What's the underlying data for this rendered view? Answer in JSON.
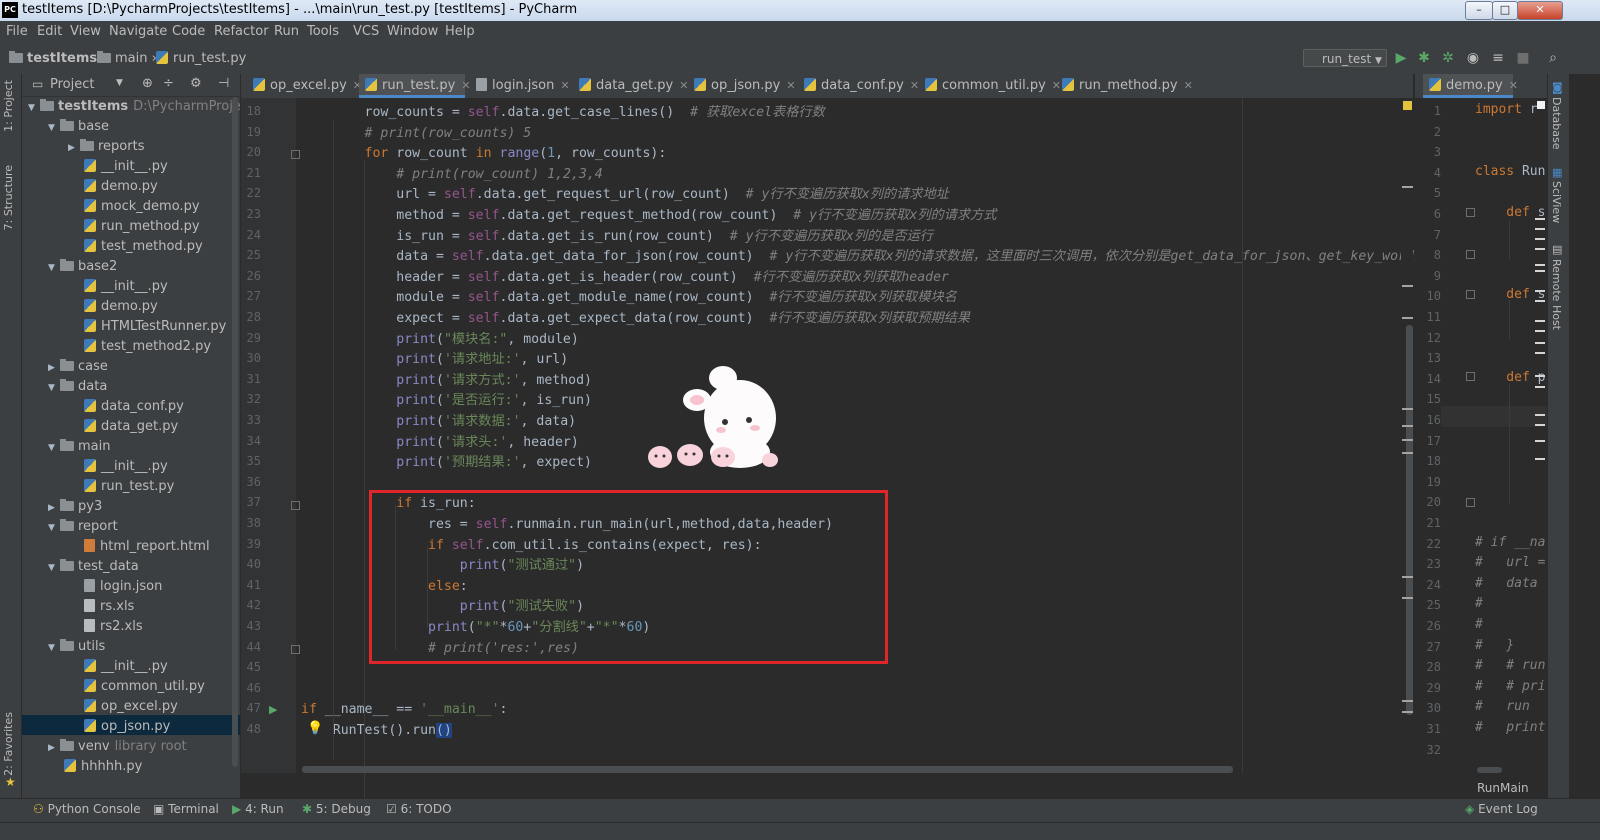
{
  "window": {
    "logo": "PC",
    "title": "testItems [D:\\PycharmProjects\\testItems] - ...\\main\\run_test.py [testItems] - PyCharm",
    "min": "–",
    "max": "□",
    "close": "✕"
  },
  "menu": [
    "File",
    "Edit",
    "View",
    "Navigate",
    "Code",
    "Refactor",
    "Run",
    "Tools",
    "VCS",
    "Window",
    "Help"
  ],
  "nav": {
    "project": "testItems",
    "folder": "main",
    "file": "run_test.py",
    "run_config": "run_test"
  },
  "left_tabs": {
    "project": "1: Project",
    "structure": "7: Structure",
    "favorites": "2: Favorites"
  },
  "project_panel": {
    "title": "Project",
    "tree": [
      {
        "label": "testItems",
        "suffix": "D:\\PycharmProjects\\t",
        "type": "folder",
        "depth": 0,
        "open": true
      },
      {
        "label": "base",
        "type": "folder",
        "depth": 1,
        "open": true
      },
      {
        "label": "reports",
        "type": "folder",
        "depth": 2,
        "open": false
      },
      {
        "label": "__init__.py",
        "type": "py",
        "depth": 2
      },
      {
        "label": "demo.py",
        "type": "py",
        "depth": 2
      },
      {
        "label": "mock_demo.py",
        "type": "py",
        "depth": 2
      },
      {
        "label": "run_method.py",
        "type": "py",
        "depth": 2
      },
      {
        "label": "test_method.py",
        "type": "py",
        "depth": 2
      },
      {
        "label": "base2",
        "type": "folder",
        "depth": 1,
        "open": true
      },
      {
        "label": "__init__.py",
        "type": "py",
        "depth": 2
      },
      {
        "label": "demo.py",
        "type": "py",
        "depth": 2
      },
      {
        "label": "HTMLTestRunner.py",
        "type": "py",
        "depth": 2
      },
      {
        "label": "test_method2.py",
        "type": "py",
        "depth": 2
      },
      {
        "label": "case",
        "type": "folder",
        "depth": 1,
        "open": false
      },
      {
        "label": "data",
        "type": "folder",
        "depth": 1,
        "open": true
      },
      {
        "label": "data_conf.py",
        "type": "py",
        "depth": 2
      },
      {
        "label": "data_get.py",
        "type": "py",
        "depth": 2
      },
      {
        "label": "main",
        "type": "folder",
        "depth": 1,
        "open": true
      },
      {
        "label": "__init__.py",
        "type": "py",
        "depth": 2
      },
      {
        "label": "run_test.py",
        "type": "py",
        "depth": 2
      },
      {
        "label": "py3",
        "type": "folder",
        "depth": 1,
        "open": false
      },
      {
        "label": "report",
        "type": "folder",
        "depth": 1,
        "open": true
      },
      {
        "label": "html_report.html",
        "type": "html",
        "depth": 2
      },
      {
        "label": "test_data",
        "type": "folder",
        "depth": 1,
        "open": true
      },
      {
        "label": "login.json",
        "type": "json",
        "depth": 2
      },
      {
        "label": "rs.xls",
        "type": "xls",
        "depth": 2
      },
      {
        "label": "rs2.xls",
        "type": "xls",
        "depth": 2
      },
      {
        "label": "utils",
        "type": "folder",
        "depth": 1,
        "open": true
      },
      {
        "label": "__init__.py",
        "type": "py",
        "depth": 2
      },
      {
        "label": "common_util.py",
        "type": "py",
        "depth": 2
      },
      {
        "label": "op_excel.py",
        "type": "py",
        "depth": 2,
        "selected": true
      },
      {
        "label": "op_json.py",
        "type": "py",
        "depth": 2
      },
      {
        "label": "venv",
        "suffix": "library root",
        "type": "folder",
        "depth": 1,
        "open": false
      },
      {
        "label": "hhhhh.py",
        "type": "py",
        "depth": 1
      }
    ]
  },
  "tabs": [
    {
      "label": "op_excel.py",
      "type": "py"
    },
    {
      "label": "run_test.py",
      "type": "py",
      "active": true
    },
    {
      "label": "login.json",
      "type": "json"
    },
    {
      "label": "data_get.py",
      "type": "py"
    },
    {
      "label": "op_json.py",
      "type": "py"
    },
    {
      "label": "data_conf.py",
      "type": "py"
    },
    {
      "label": "common_util.py",
      "type": "py"
    },
    {
      "label": "run_method.py",
      "type": "py"
    }
  ],
  "split_tab": {
    "label": "demo.py"
  },
  "right_tabs": {
    "database": "Database",
    "sciview": "SciView",
    "remote": "Remote Host"
  },
  "editor": {
    "line_numbers": [
      "18",
      "19",
      "20",
      "21",
      "22",
      "23",
      "24",
      "25",
      "26",
      "27",
      "28",
      "29",
      "30",
      "31",
      "32",
      "33",
      "34",
      "35",
      "36",
      "37",
      "38",
      "39",
      "40",
      "41",
      "42",
      "43",
      "44",
      "45",
      "46",
      "47",
      "48"
    ],
    "lines": [
      [
        [
          "",
          "        row_counts = "
        ],
        [
          "sf",
          "self"
        ],
        [
          "",
          ".data.get_case_lines()  "
        ],
        [
          "cm",
          "# 获取excel表格行数"
        ]
      ],
      [
        [
          "cm",
          "        # print(row_counts) 5"
        ]
      ],
      [
        [
          "kw",
          "        for "
        ],
        [
          "",
          "row_count "
        ],
        [
          "kw",
          "in "
        ],
        [
          "bi",
          "range"
        ],
        [
          "",
          "("
        ],
        [
          "nm",
          "1"
        ],
        [
          "",
          ", row_counts):"
        ]
      ],
      [
        [
          "cm",
          "            # print(row_count) 1,2,3,4"
        ]
      ],
      [
        [
          "",
          "            url = "
        ],
        [
          "sf",
          "self"
        ],
        [
          "",
          ".data.get_request_url(row_count)  "
        ],
        [
          "cm",
          "# y行不变遍历获取x列的请求地址"
        ]
      ],
      [
        [
          "",
          "            method = "
        ],
        [
          "sf",
          "self"
        ],
        [
          "",
          ".data.get_request_method(row_count)  "
        ],
        [
          "cm",
          "# y行不变遍历获取x列的请求方式"
        ]
      ],
      [
        [
          "",
          "            is_run = "
        ],
        [
          "sf",
          "self"
        ],
        [
          "",
          ".data.get_is_run(row_count)  "
        ],
        [
          "cm",
          "# y行不变遍历获取x列的是否运行"
        ]
      ],
      [
        [
          "",
          "            data = "
        ],
        [
          "sf",
          "self"
        ],
        [
          "",
          ".data.get_data_for_json(row_count)  "
        ],
        [
          "cm",
          "# y行不变遍历获取x列的请求数据，这里面时三次调用，依次分别是get_data_for_json、get_key_words"
        ]
      ],
      [
        [
          "",
          "            header = "
        ],
        [
          "sf",
          "self"
        ],
        [
          "",
          ".data.get_is_header(row_count)  "
        ],
        [
          "cm",
          "#行不变遍历获取x列获取header"
        ]
      ],
      [
        [
          "",
          "            module = "
        ],
        [
          "sf",
          "self"
        ],
        [
          "",
          ".data.get_module_name(row_count)  "
        ],
        [
          "cm",
          "#行不变遍历获取x列获取模块名"
        ]
      ],
      [
        [
          "",
          "            expect = "
        ],
        [
          "sf",
          "self"
        ],
        [
          "",
          ".data.get_expect_data(row_count)  "
        ],
        [
          "cm",
          "#行不变遍历获取x列获取预期结果"
        ]
      ],
      [
        [
          "bi",
          "            print"
        ],
        [
          "",
          "("
        ],
        [
          "st",
          "\"模块名:\""
        ],
        [
          "",
          ", module)"
        ]
      ],
      [
        [
          "bi",
          "            print"
        ],
        [
          "",
          "("
        ],
        [
          "st",
          "'请求地址:'"
        ],
        [
          "",
          ", url)"
        ]
      ],
      [
        [
          "bi",
          "            print"
        ],
        [
          "",
          "("
        ],
        [
          "st",
          "'请求方式:'"
        ],
        [
          "",
          ", method)"
        ]
      ],
      [
        [
          "bi",
          "            print"
        ],
        [
          "",
          "("
        ],
        [
          "st",
          "'是否运行:'"
        ],
        [
          "",
          ", is_run)"
        ]
      ],
      [
        [
          "bi",
          "            print"
        ],
        [
          "",
          "("
        ],
        [
          "st",
          "'请求数据:'"
        ],
        [
          "",
          ", data)"
        ]
      ],
      [
        [
          "bi",
          "            print"
        ],
        [
          "",
          "("
        ],
        [
          "st",
          "'请求头:'"
        ],
        [
          "",
          ", header)"
        ]
      ],
      [
        [
          "bi",
          "            print"
        ],
        [
          "",
          "("
        ],
        [
          "st",
          "'预期结果:'"
        ],
        [
          "",
          ", expect)"
        ]
      ],
      [
        [
          "",
          ""
        ]
      ],
      [
        [
          "kw",
          "            if "
        ],
        [
          "",
          "is_run:"
        ]
      ],
      [
        [
          "",
          "                res = "
        ],
        [
          "sf",
          "self"
        ],
        [
          "",
          ".runmain.run_main(url,method,data,header)"
        ]
      ],
      [
        [
          "kw",
          "                if "
        ],
        [
          "sf",
          "self"
        ],
        [
          "",
          ".com_util.is_contains(expect, res):"
        ]
      ],
      [
        [
          "bi",
          "                    print"
        ],
        [
          "",
          "("
        ],
        [
          "st",
          "\"测试通过\""
        ],
        [
          "",
          ")"
        ]
      ],
      [
        [
          "kw",
          "                else"
        ],
        [
          "",
          ":"
        ]
      ],
      [
        [
          "bi",
          "                    print"
        ],
        [
          "",
          "("
        ],
        [
          "st",
          "\"测试失败\""
        ],
        [
          "",
          ")"
        ]
      ],
      [
        [
          "bi",
          "                print"
        ],
        [
          "",
          "("
        ],
        [
          "st",
          "\"*\""
        ],
        [
          "",
          "*"
        ],
        [
          "nm",
          "60"
        ],
        [
          "",
          "+"
        ],
        [
          "st",
          "\"分割线\""
        ],
        [
          "",
          "+"
        ],
        [
          "st",
          "\"*\""
        ],
        [
          "",
          "*"
        ],
        [
          "nm",
          "60"
        ],
        [
          "",
          ")"
        ]
      ],
      [
        [
          "cm",
          "                # print('res:',res)"
        ]
      ],
      [
        [
          "",
          ""
        ]
      ],
      [
        [
          "",
          ""
        ]
      ],
      [
        [
          "kw",
          "if "
        ],
        [
          "",
          "__name__ == "
        ],
        [
          "st",
          "'__main__'"
        ],
        [
          "",
          ":"
        ]
      ],
      [
        [
          "",
          "    RunTest().run"
        ],
        [
          "sel",
          "()"
        ]
      ]
    ]
  },
  "split_editor": {
    "line_numbers": [
      "1",
      "2",
      "3",
      "4",
      "5",
      "6",
      "7",
      "8",
      "9",
      "10",
      "11",
      "12",
      "13",
      "14",
      "15",
      "16",
      "17",
      "18",
      "19",
      "20",
      "21",
      "22",
      "23",
      "24",
      "25",
      "26",
      "27",
      "28",
      "29",
      "30",
      "31",
      "32"
    ],
    "lines": [
      [
        [
          "kw",
          "import "
        ],
        [
          "",
          "r"
        ]
      ],
      [
        [
          "",
          ""
        ]
      ],
      [
        [
          "",
          ""
        ]
      ],
      [
        [
          "kw",
          "class "
        ],
        [
          "",
          "Run"
        ]
      ],
      [
        [
          "",
          ""
        ]
      ],
      [
        [
          "kw",
          "    def "
        ],
        [
          "",
          "s"
        ]
      ],
      [
        [
          "",
          ""
        ]
      ],
      [
        [
          "",
          ""
        ]
      ],
      [
        [
          "",
          ""
        ]
      ],
      [
        [
          "kw",
          "    def "
        ],
        [
          "",
          "s"
        ]
      ],
      [
        [
          "",
          ""
        ]
      ],
      [
        [
          "",
          ""
        ]
      ],
      [
        [
          "",
          ""
        ]
      ],
      [
        [
          "kw",
          "    def "
        ],
        [
          "",
          "p"
        ]
      ],
      [
        [
          "",
          ""
        ]
      ],
      [
        [
          "",
          ""
        ]
      ],
      [
        [
          "",
          ""
        ]
      ],
      [
        [
          "",
          ""
        ]
      ],
      [
        [
          "",
          ""
        ]
      ],
      [
        [
          "",
          ""
        ]
      ],
      [
        [
          "",
          ""
        ]
      ],
      [
        [
          "cm",
          "# if __na"
        ]
      ],
      [
        [
          "cm",
          "#   url ="
        ]
      ],
      [
        [
          "cm",
          "#   data"
        ]
      ],
      [
        [
          "cm",
          "#"
        ]
      ],
      [
        [
          "cm",
          "#"
        ]
      ],
      [
        [
          "cm",
          "#   }"
        ]
      ],
      [
        [
          "cm",
          "#   # run"
        ]
      ],
      [
        [
          "cm",
          "#   # pri"
        ]
      ],
      [
        [
          "cm",
          "#   run"
        ]
      ],
      [
        [
          "cm",
          "#   print"
        ]
      ],
      [
        [
          "",
          ""
        ]
      ]
    ],
    "footer": "RunMain"
  },
  "bottom_tabs": [
    {
      "label": "Python Console",
      "icon": "python-console-icon"
    },
    {
      "label": "Terminal",
      "icon": "terminal-icon"
    },
    {
      "label": "4: Run",
      "icon": "run-icon"
    },
    {
      "label": "5: Debug",
      "icon": "debug-icon"
    },
    {
      "label": "6: TODO",
      "icon": "todo-icon"
    }
  ],
  "event_log": "Event Log",
  "colors": {
    "keyword": "#cc7832",
    "self": "#94558d",
    "comment": "#808080",
    "string": "#6a8759",
    "number": "#6897bb",
    "builtin": "#8888c6",
    "highlight_box": "#e0252b"
  }
}
